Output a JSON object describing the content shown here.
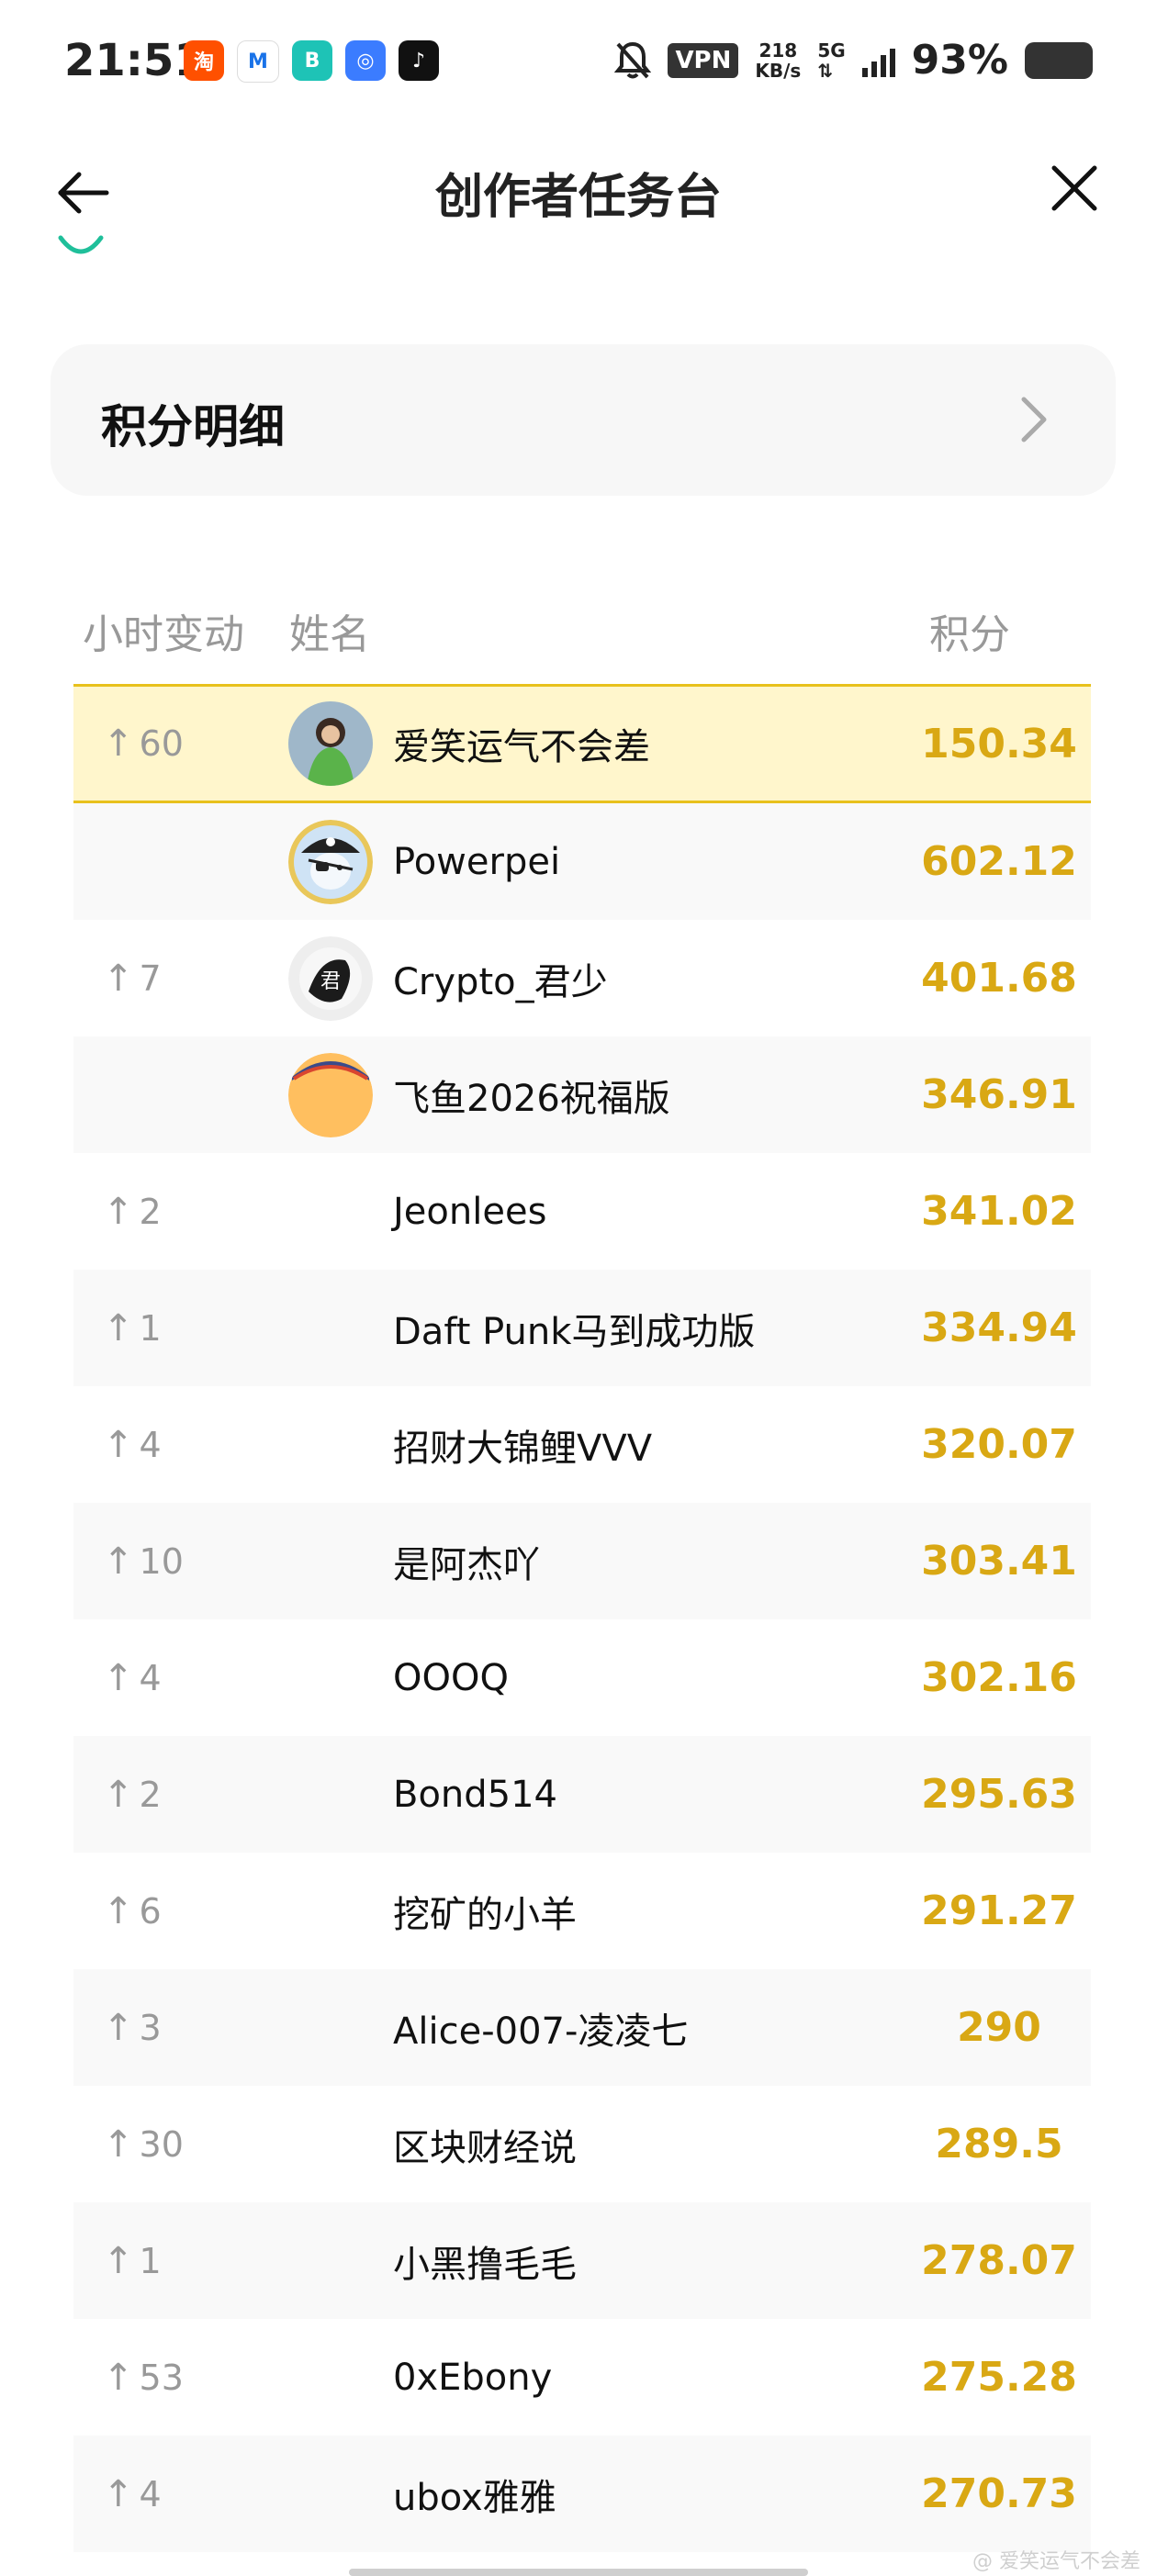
{
  "status_bar": {
    "time": "21:51",
    "vpn": "VPN",
    "speed_value": "218",
    "speed_unit": "KB/s",
    "network": "5G",
    "battery": "93%",
    "apps": [
      {
        "icon": "taobao-icon",
        "glyph": "淘",
        "color": "#ff5000"
      },
      {
        "icon": "mail-icon",
        "glyph": "M",
        "color": "#ffffff"
      },
      {
        "icon": "boss-icon",
        "glyph": "B",
        "color": "#1ec3b6"
      },
      {
        "icon": "browser-icon",
        "glyph": "◎",
        "color": "#3b7cff"
      },
      {
        "icon": "music-icon",
        "glyph": "♪",
        "color": "#111111"
      }
    ]
  },
  "header": {
    "title": "创作者任务台"
  },
  "card": {
    "label": "积分明细"
  },
  "table": {
    "headers": {
      "change": "小时变动",
      "name": "姓名",
      "score": "积分"
    },
    "rows": [
      {
        "change": "60",
        "name": "爱笑运气不会差",
        "score": "150.34",
        "avatar": "photo",
        "me": true
      },
      {
        "change": "",
        "name": "Powerpei",
        "score": "602.12",
        "avatar": "pirate"
      },
      {
        "change": "7",
        "name": "Crypto_君少",
        "score": "401.68",
        "avatar": "ink"
      },
      {
        "change": "",
        "name": "飞鱼2026祝福版",
        "score": "346.91",
        "avatar": "orange"
      },
      {
        "change": "2",
        "name": "Jeonlees",
        "score": "341.02"
      },
      {
        "change": "1",
        "name": "Daft Punk马到成功版",
        "score": "334.94"
      },
      {
        "change": "4",
        "name": "招财大锦鲤VVV",
        "score": "320.07"
      },
      {
        "change": "10",
        "name": "是阿杰吖",
        "score": "303.41"
      },
      {
        "change": "4",
        "name": "OOOQ",
        "score": "302.16"
      },
      {
        "change": "2",
        "name": "Bond514",
        "score": "295.63"
      },
      {
        "change": "6",
        "name": "挖矿的小羊",
        "score": "291.27"
      },
      {
        "change": "3",
        "name": "Alice-007-凌凌七",
        "score": "290"
      },
      {
        "change": "30",
        "name": "区块财经说",
        "score": "289.5"
      },
      {
        "change": "1",
        "name": "小黑撸毛毛",
        "score": "278.07"
      },
      {
        "change": "53",
        "name": "0xEbony",
        "score": "275.28"
      },
      {
        "change": "4",
        "name": "ubox雅雅",
        "score": "270.73"
      }
    ]
  },
  "watermark": "@ 爱笑运气不会差",
  "colors": {
    "accent": "#d9a814",
    "highlight_bg": "#fff6cc",
    "highlight_border": "#e8c11c",
    "teal": "#1fbf9a"
  }
}
